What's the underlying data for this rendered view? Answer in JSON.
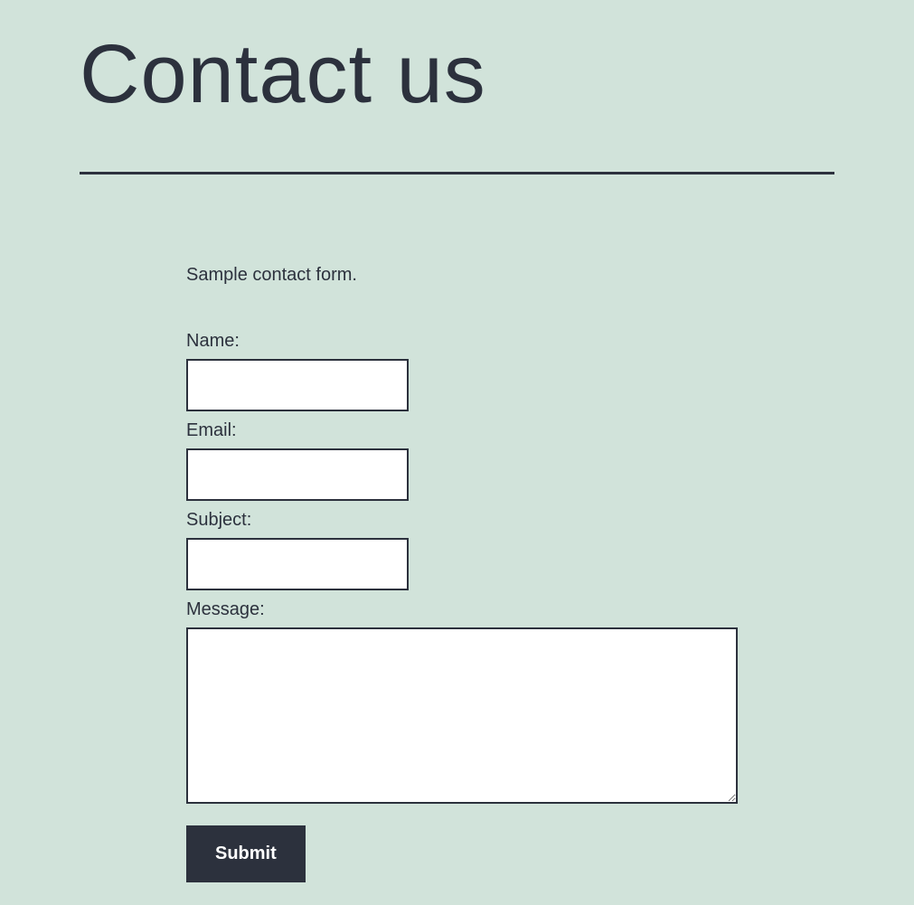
{
  "header": {
    "title": "Contact us"
  },
  "form": {
    "intro": "Sample contact form.",
    "fields": {
      "name_label": "Name:",
      "name_value": "",
      "email_label": "Email:",
      "email_value": "",
      "subject_label": "Subject:",
      "subject_value": "",
      "message_label": "Message:",
      "message_value": ""
    },
    "submit_label": "Submit"
  }
}
